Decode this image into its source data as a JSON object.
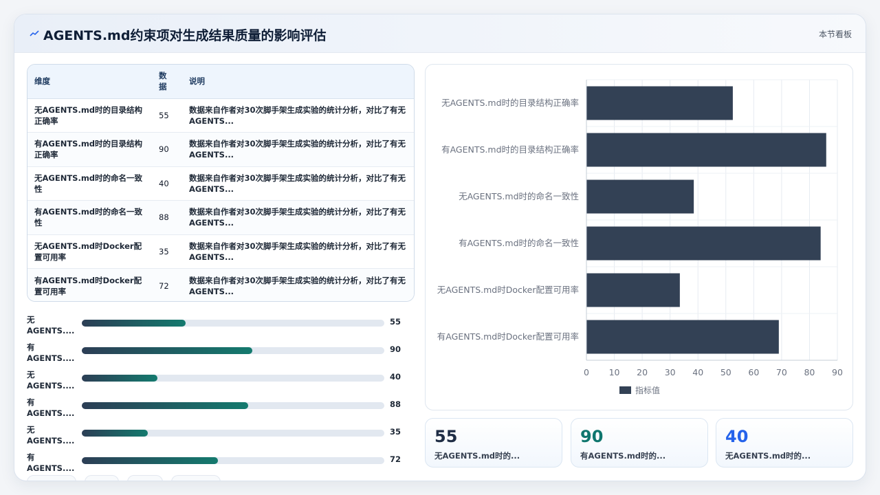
{
  "header": {
    "title": "AGENTS.md约束项对生成结果质量的影响评估",
    "right_label": "本节看板"
  },
  "table": {
    "columns": [
      "维度",
      "数据",
      "说明"
    ],
    "rows": [
      {
        "dim": "无AGENTS.md时的目录结构正确率",
        "value": "55",
        "desc": "数据来自作者对30次脚手架生成实验的统计分析，对比了有无AGENTS..."
      },
      {
        "dim": "有AGENTS.md时的目录结构正确率",
        "value": "90",
        "desc": "数据来自作者对30次脚手架生成实验的统计分析，对比了有无AGENTS..."
      },
      {
        "dim": "无AGENTS.md时的命名一致性",
        "value": "40",
        "desc": "数据来自作者对30次脚手架生成实验的统计分析，对比了有无AGENTS..."
      },
      {
        "dim": "有AGENTS.md时的命名一致性",
        "value": "88",
        "desc": "数据来自作者对30次脚手架生成实验的统计分析，对比了有无AGENTS..."
      },
      {
        "dim": "无AGENTS.md时Docker配置可用率",
        "value": "35",
        "desc": "数据来自作者对30次脚手架生成实验的统计分析，对比了有无AGENTS..."
      },
      {
        "dim": "有AGENTS.md时Docker配置可用率",
        "value": "72",
        "desc": "数据来自作者对30次脚手架生成实验的统计分析，对比了有无AGENTS..."
      }
    ]
  },
  "progress": [
    {
      "label": "无AGENTS....",
      "value": 55,
      "display": "55"
    },
    {
      "label": "有AGENTS....",
      "value": 90,
      "display": "90"
    },
    {
      "label": "无AGENTS....",
      "value": 40,
      "display": "40"
    },
    {
      "label": "有AGENTS....",
      "value": 88,
      "display": "88"
    },
    {
      "label": "无AGENTS....",
      "value": 35,
      "display": "35"
    },
    {
      "label": "有AGENTS....",
      "value": 72,
      "display": "72"
    }
  ],
  "progress_max": 160,
  "chart_data": {
    "type": "bar",
    "orientation": "horizontal",
    "categories": [
      "无AGENTS.md时的目录结构正确率",
      "有AGENTS.md时的目录结构正确率",
      "无AGENTS.md时的命名一致性",
      "有AGENTS.md时的命名一致性",
      "无AGENTS.md时Docker配置可用率",
      "有AGENTS.md时Docker配置可用率"
    ],
    "series": [
      {
        "name": "指标值",
        "values": [
          52.5,
          86,
          38.5,
          84,
          33.5,
          69
        ]
      }
    ],
    "xlim": [
      0,
      90
    ],
    "xticks": [
      0,
      10,
      20,
      30,
      40,
      50,
      60,
      70,
      80,
      90
    ],
    "grid": true,
    "legend": "bottom",
    "color": "#334155"
  },
  "stats": [
    {
      "value": "55",
      "label": "无AGENTS.md时的...",
      "color": "#1f2d45"
    },
    {
      "value": "90",
      "label": "有AGENTS.md时的...",
      "color": "#0f766e"
    },
    {
      "value": "40",
      "label": "无AGENTS.md时的...",
      "color": "#2563eb"
    }
  ],
  "colors": {
    "accent": "#334155",
    "teal": "#147a6e",
    "blue": "#2563eb"
  }
}
